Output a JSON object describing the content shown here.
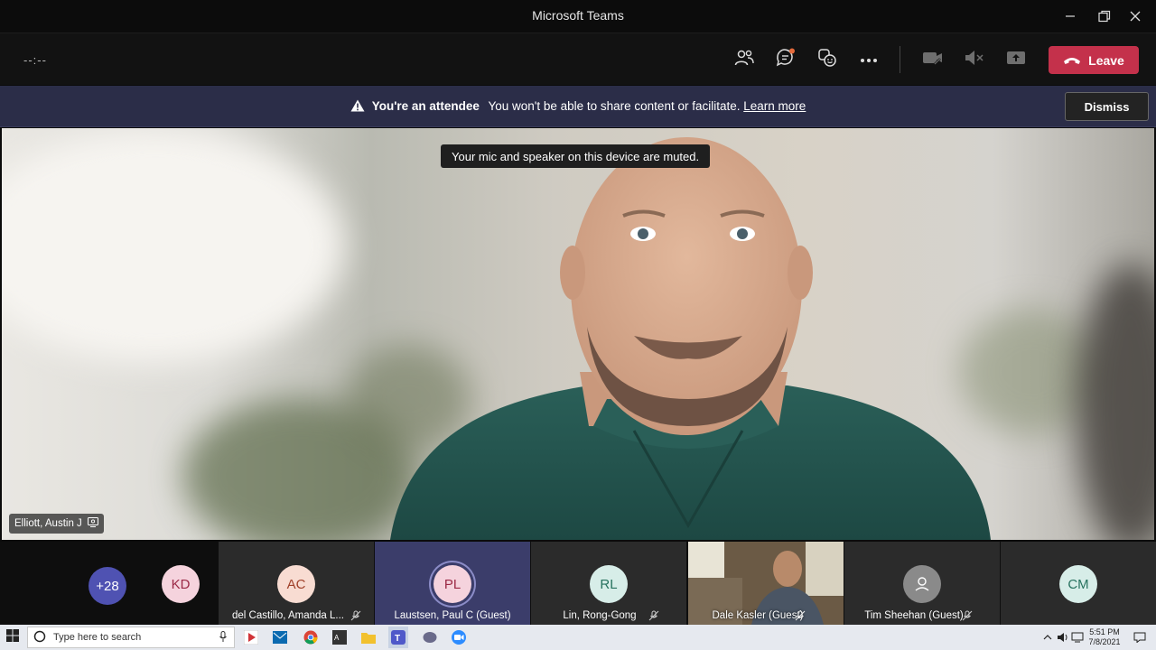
{
  "window": {
    "title": "Microsoft Teams"
  },
  "toolbar": {
    "timer": "--:--",
    "leave_label": "Leave"
  },
  "banner": {
    "bold": "You're an attendee",
    "text": "You won't be able to share content or facilitate.",
    "link": "Learn more",
    "dismiss_label": "Dismiss"
  },
  "stage": {
    "toast": "Your mic and speaker on this device are muted.",
    "speaker_name": "Elliott, Austin J"
  },
  "gallery": {
    "overflow_count": "+28",
    "tiles": [
      {
        "initials": "KD",
        "name": ""
      },
      {
        "initials": "AC",
        "name": "del Castillo, Amanda L..."
      },
      {
        "initials": "PL",
        "name": "Laustsen, Paul C (Guest)"
      },
      {
        "initials": "RL",
        "name": "Lin, Rong-Gong"
      },
      {
        "initials": "",
        "name": "Dale Kasler (Guest)"
      },
      {
        "initials": "",
        "name": "Tim Sheehan (Guest)"
      },
      {
        "initials": "CM",
        "name": ""
      }
    ]
  },
  "taskbar": {
    "search_placeholder": "Type here to search",
    "time": "5:51 PM",
    "date": "7/8/2021"
  },
  "colors": {
    "leave": "#c4314b",
    "banner": "#2b2d48",
    "active_ring": "#8b8cc7"
  }
}
